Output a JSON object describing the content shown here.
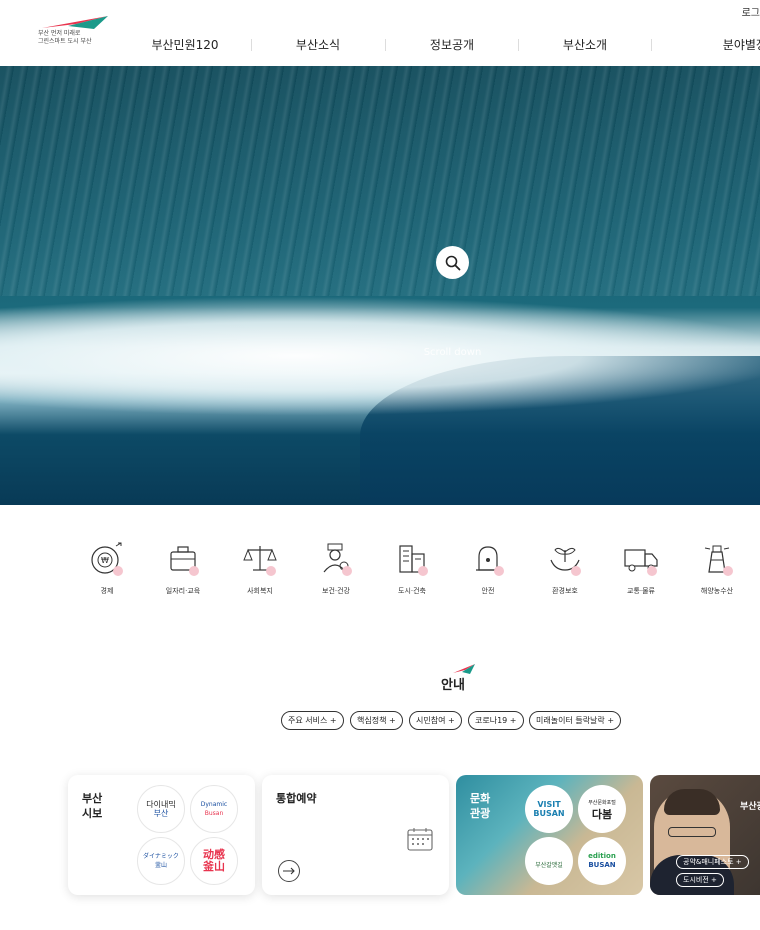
{
  "header": {
    "login": "로그",
    "logo_line1": "부산 먼저 미래로",
    "logo_line2": "그린스마트 도시 부산",
    "nav": [
      "부산민원120",
      "부산소식",
      "정보공개",
      "부산소개",
      "분야별정보"
    ]
  },
  "hero": {
    "scroll_label": "Scroll down"
  },
  "categories": [
    {
      "label": "경제",
      "icon": "economy-icon"
    },
    {
      "label": "일자리·교육",
      "icon": "briefcase-icon"
    },
    {
      "label": "사회복지",
      "icon": "scale-icon"
    },
    {
      "label": "보건·건강",
      "icon": "doctor-icon"
    },
    {
      "label": "도시·건축",
      "icon": "building-icon"
    },
    {
      "label": "안전",
      "icon": "siren-icon"
    },
    {
      "label": "환경보호",
      "icon": "plant-hands-icon"
    },
    {
      "label": "교통·물류",
      "icon": "truck-icon"
    },
    {
      "label": "해양농수산",
      "icon": "lighthouse-icon"
    }
  ],
  "notice": {
    "title": "안내",
    "tags": [
      "주요 서비스 +",
      "핵심정책 +",
      "시민참여 +",
      "코로나19 +",
      "미래놀이터 들락날락 +"
    ]
  },
  "cards": {
    "sibo": {
      "title_line1": "부산",
      "title_line2": "시보",
      "circles": [
        {
          "line1": "다이내믹",
          "line2": "부산"
        },
        {
          "line1": "Dynamic",
          "line2": "Busan"
        },
        {
          "line1": "ダイナミック",
          "line2": "釜山"
        },
        {
          "line1": "动感",
          "line2": "釜山"
        }
      ]
    },
    "reservation": {
      "title": "통합예약"
    },
    "culture": {
      "title_line1": "문화",
      "title_line2": "관광",
      "circles": [
        {
          "line1": "VISIT",
          "line2": "BUSAN"
        },
        {
          "line1": "부산문화포털",
          "line2": "다봄"
        },
        {
          "line1": "",
          "line2": "부산갈맷길"
        },
        {
          "line1": "edition",
          "line2": "BUSAN"
        }
      ]
    },
    "mayor": {
      "label": "부산광",
      "pills": [
        "공약&매니페스토 +",
        "도시비전 +"
      ]
    }
  },
  "colors": {
    "accent_red": "#e8344e",
    "accent_teal": "#1a9a8a",
    "pink_dot": "#f5c6cf"
  }
}
